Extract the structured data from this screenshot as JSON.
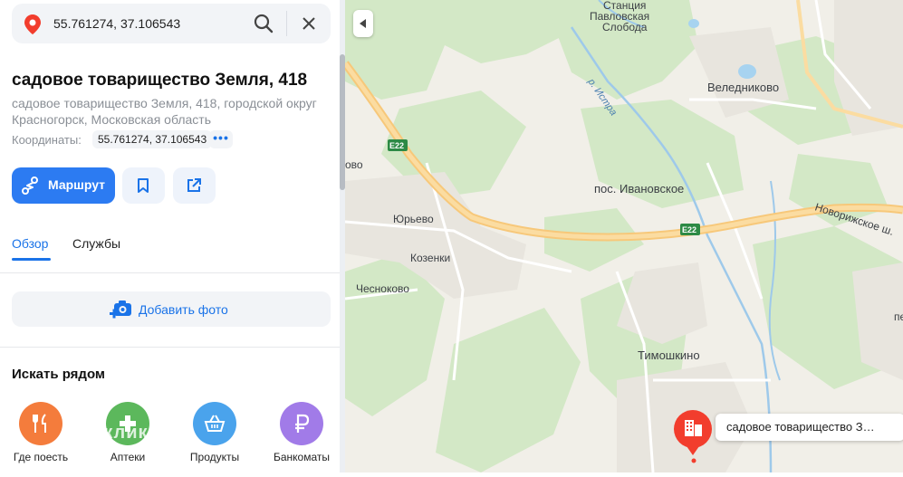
{
  "search": {
    "query": "55.761274, 37.106543"
  },
  "place": {
    "title": "садовое товарищество Земля, 418",
    "address": "садовое товарищество Земля, 418, городской округ Красногорск, Московская область",
    "coords_label": "Координаты:",
    "coords_value": "55.761274, 37.106543",
    "more": "•••"
  },
  "actions": {
    "route_label": "Маршрут"
  },
  "tabs": [
    {
      "label": "Обзор",
      "active": true
    },
    {
      "label": "Службы",
      "active": false
    }
  ],
  "add_photo_label": "Добавить фото",
  "nearby": {
    "heading": "Искать рядом",
    "items": [
      {
        "label": "Где поесть",
        "icon": "fork-knife-icon",
        "color": "#f47c3c"
      },
      {
        "label": "Аптеки",
        "icon": "plus-icon",
        "color": "#5cb85c"
      },
      {
        "label": "Продукты",
        "icon": "basket-icon",
        "color": "#4aa3ec"
      },
      {
        "label": "Банкоматы",
        "icon": "ruble-icon",
        "color": "#a17be8"
      }
    ]
  },
  "watermark": "Домклик",
  "map": {
    "labels": {
      "station": "Станция",
      "pavlovskaya": "Павловская",
      "sloboda": "Слобода",
      "istra": "р. Истра",
      "veledn": "Веледниково",
      "ivanovskoe": "пос. Ивановское",
      "yurevo": "Юрьево",
      "kozenki": "Козенки",
      "chesnokovo": "Чесноково",
      "timoshkino": "Тимошкино",
      "novorizh": "Новорижское ш.",
      "e22a": "E22",
      "e22b": "E22",
      "ovo": "ово",
      "pe": "пе"
    },
    "callout": "садовое товарищество З…"
  },
  "colors": {
    "accent": "#2c7bf2",
    "marker": "#f23d2d"
  }
}
